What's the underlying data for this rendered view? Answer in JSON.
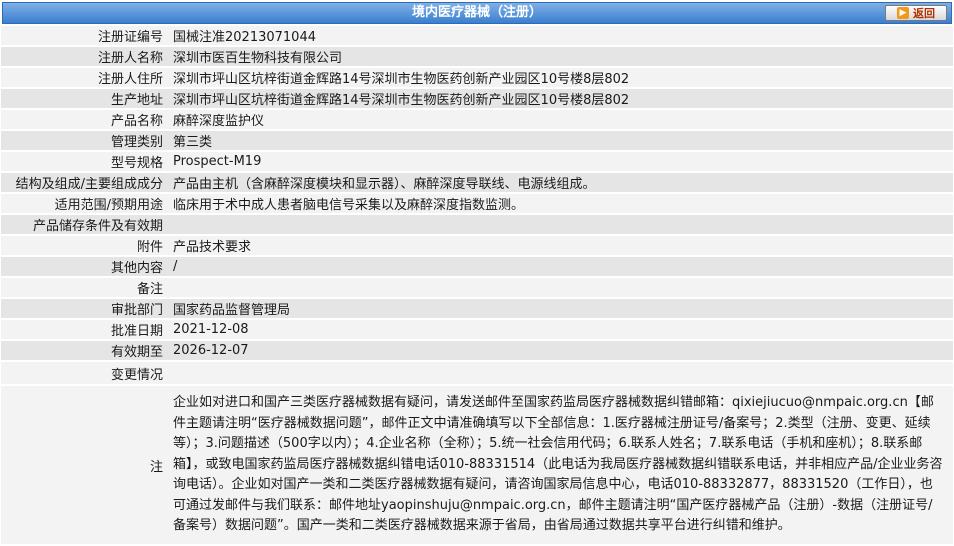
{
  "header": {
    "title": "境内医疗器械（注册）",
    "back_label": "返回"
  },
  "rows": [
    {
      "label": "注册证编号",
      "value": "国械注准20213071044"
    },
    {
      "label": "注册人名称",
      "value": "深圳市医百生物科技有限公司"
    },
    {
      "label": "注册人住所",
      "value": "深圳市坪山区坑梓街道金辉路14号深圳市生物医药创新产业园区10号楼8层802"
    },
    {
      "label": "生产地址",
      "value": "深圳市坪山区坑梓街道金辉路14号深圳市生物医药创新产业园区10号楼8层802"
    },
    {
      "label": "产品名称",
      "value": "麻醉深度监护仪"
    },
    {
      "label": "管理类别",
      "value": "第三类"
    },
    {
      "label": "型号规格",
      "value": "Prospect-M19"
    },
    {
      "label": "结构及组成/主要组成成分",
      "value": "产品由主机（含麻醉深度模块和显示器）、麻醉深度导联线、电源线组成。"
    },
    {
      "label": "适用范围/预期用途",
      "value": "临床用于术中成人患者脑电信号采集以及麻醉深度指数监测。"
    },
    {
      "label": "产品储存条件及有效期",
      "value": ""
    },
    {
      "label": "附件",
      "value": "产品技术要求"
    },
    {
      "label": "其他内容",
      "value": "/"
    },
    {
      "label": "备注",
      "value": ""
    },
    {
      "label": "审批部门",
      "value": "国家药品监督管理局"
    },
    {
      "label": "批准日期",
      "value": "2021-12-08"
    },
    {
      "label": "有效期至",
      "value": "2026-12-07"
    },
    {
      "label": "变更情况",
      "value": ""
    }
  ],
  "note": {
    "label": "注",
    "text": "企业如对进口和国产三类医疗器械数据有疑问，请发送邮件至国家药监局医疗器械数据纠错邮箱：qixiejiucuo@nmpaic.org.cn【邮件主题请注明“医疗器械数据问题”，邮件正文中请准确填写以下全部信息：1.医疗器械注册证号/备案号；2.类型（注册、变更、延续等）；3.问题描述（500字以内）；4.企业名称（全称）；5.统一社会信用代码；6.联系人姓名；7.联系电话（手机和座机）；8.联系邮箱】，或致电国家药监局医疗器械数据纠错电话010-88331514（此电话为我局医疗器械数据纠错联系电话，并非相应产品/企业业务咨询电话）。企业如对国产一类和二类医疗器械数据有疑问，请咨询国家局信息中心，电话010-88332877，88331520（工作日），也可通过发邮件与我们联系：邮件地址yaopinshuju@nmpaic.org.cn，邮件主题请注明“国产医疗器械产品（注册）-数据（注册证号/备案号）数据问题”。国产一类和二类医疗器械数据来源于省局，由省局通过数据共享平台进行纠错和维护。"
  }
}
